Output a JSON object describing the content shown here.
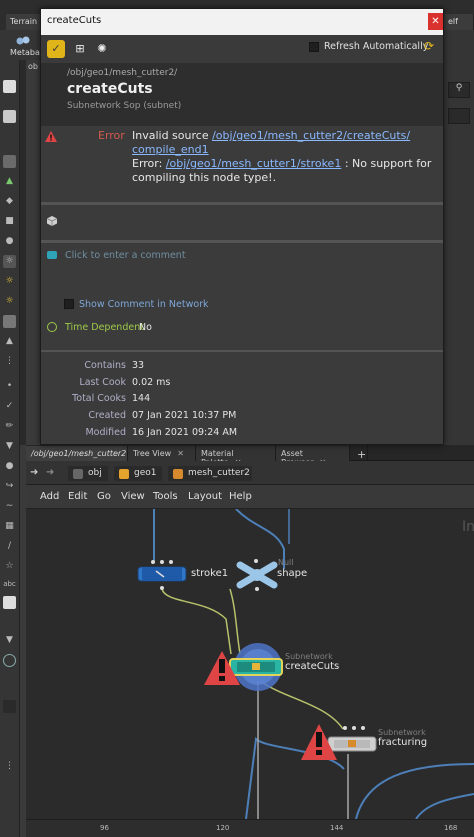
{
  "colors": {
    "error": "#d15a4e",
    "link": "#8ab9ff",
    "timeDependent": "#9ec94a",
    "subnetNode": "#2ab4a3",
    "strokeNode": "#2f76c8",
    "warning": "#e04545"
  },
  "background": {
    "top_tabs": [
      "Terrain FX",
      "elf"
    ],
    "shelf_item": "Metaball",
    "obj_label": "ob",
    "toolbar_abc": "abc"
  },
  "pane_tabs": [
    "/obj/geo1/mesh_cutter2",
    "Tree View",
    "Material Palette",
    "Asset Browser",
    "+"
  ],
  "breadcrumbs": [
    "obj",
    "geo1",
    "mesh_cutter2"
  ],
  "menu": [
    "Add",
    "Edit",
    "Go",
    "View",
    "Tools",
    "Layout",
    "Help"
  ],
  "network": {
    "nodes": [
      {
        "name": "stroke1",
        "type": ""
      },
      {
        "name": "shape",
        "type": "Null"
      },
      {
        "name": "createCuts",
        "type": "Subnetwork"
      },
      {
        "name": "fracturing",
        "type": "Subnetwork"
      }
    ],
    "corner_label": "In",
    "ruler_ticks": [
      "96",
      "120",
      "144",
      "168"
    ]
  },
  "popup": {
    "window_title": "createCuts",
    "close_glyph": "✕",
    "refresh_label": "Refresh Automatically",
    "node_path": "/obj/geo1/mesh_cutter2/",
    "node_name": "createCuts",
    "node_subtype": "Subnetwork Sop (subnet)",
    "error_label": "Error",
    "error_prefix": "Invalid source ",
    "error_link1a": "/obj/geo1/mesh_cutter2/createCuts/",
    "error_link1b": "compile_end1",
    "error_prefix2": "Error: ",
    "error_link2": "/obj/geo1/mesh_cutter1/stroke1",
    "error_suffix": " : No support for compiling this node type!.",
    "comment_placeholder": "Click to enter a comment",
    "show_comment_label": "Show Comment in Network",
    "time_dependent_label": "Time Dependent",
    "time_dependent_value": "No",
    "stats": [
      {
        "key": "Contains",
        "value": "33"
      },
      {
        "key": "Last Cook",
        "value": "0.02 ms"
      },
      {
        "key": "Total Cooks",
        "value": "144"
      },
      {
        "key": "Created",
        "value": "07 Jan 2021 10:37 PM"
      },
      {
        "key": "Modified",
        "value": "16 Jan 2021 09:24 AM"
      }
    ]
  }
}
